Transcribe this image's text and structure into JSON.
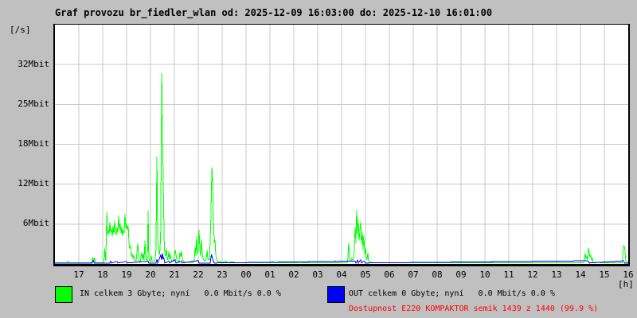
{
  "title": "Graf provozu br_fiedler_wlan od: 2025-12-09 16:03:00 do: 2025-12-10 16:01:00",
  "colors": {
    "background": "#c0c0c0",
    "plot_background": "#ffffff",
    "grid": "#c9c9c9",
    "border": "#000000",
    "in": "#00ff00",
    "out": "#0000ff",
    "availability_text": "#ff0000"
  },
  "legend": {
    "in": {
      "label": "IN celkem 3 Gbyte; nyní   0.0 Mbit/s 0.0 %",
      "color": "#00ff00"
    },
    "out": {
      "label": "OUT celkem 0 Gbyte; nyní   0.0 Mbit/s 0.0 %",
      "color": "#0000ff"
    },
    "availability": {
      "label": "Dostupnost E220 KOMPAKTOR semik 1439 z 1440 (99.9 %)",
      "color": "#ff0000"
    }
  },
  "chart_data": {
    "type": "line",
    "title": "Graf provozu br_fiedler_wlan od: 2025-12-09 16:03:00 do: 2025-12-10 16:01:00",
    "y_unit_label": "[/s]",
    "x_unit_label": "[h]",
    "y_tick_labels": [
      "32Mbit",
      "25Mbit",
      "18Mbit",
      "12Mbit",
      "6Mbit"
    ],
    "x_tick_labels": [
      "17",
      "18",
      "19",
      "20",
      "21",
      "22",
      "23",
      "00",
      "01",
      "02",
      "03",
      "04",
      "05",
      "06",
      "07",
      "08",
      "09",
      "10",
      "11",
      "12",
      "13",
      "14",
      "15",
      "16"
    ],
    "x_range_hours": [
      16.05,
      40.0
    ],
    "y_scale_mbit_per_gridline": 6,
    "grid": true,
    "legend_position": "bottom",
    "series": [
      {
        "name": "IN",
        "unit": "Mbit/s",
        "color_key": "in",
        "points": [
          [
            16.0,
            0.05
          ],
          [
            16.5,
            0.05
          ],
          [
            16.55,
            0.3
          ],
          [
            16.6,
            0.05
          ],
          [
            17.55,
            0.05
          ],
          [
            17.58,
            0.9
          ],
          [
            17.62,
            0.3
          ],
          [
            17.65,
            0.8
          ],
          [
            17.7,
            0.1
          ],
          [
            17.9,
            0.05
          ],
          [
            18.05,
            0.1
          ],
          [
            18.08,
            2.2
          ],
          [
            18.12,
            0.5
          ],
          [
            18.13,
            0.4
          ],
          [
            18.17,
            7.7
          ],
          [
            18.2,
            4.2
          ],
          [
            18.23,
            5.0
          ],
          [
            18.27,
            4.4
          ],
          [
            18.3,
            6.2
          ],
          [
            18.33,
            4.6
          ],
          [
            18.37,
            5.2
          ],
          [
            18.4,
            4.0
          ],
          [
            18.43,
            5.6
          ],
          [
            18.47,
            4.3
          ],
          [
            18.5,
            6.4
          ],
          [
            18.53,
            4.8
          ],
          [
            18.57,
            4.2
          ],
          [
            18.6,
            5.4
          ],
          [
            18.63,
            4.6
          ],
          [
            18.67,
            7.1
          ],
          [
            18.7,
            5.0
          ],
          [
            18.73,
            6.0
          ],
          [
            18.77,
            4.4
          ],
          [
            18.8,
            5.5
          ],
          [
            18.83,
            4.1
          ],
          [
            18.87,
            5.0
          ],
          [
            18.9,
            4.5
          ],
          [
            18.93,
            7.4
          ],
          [
            18.97,
            5.2
          ],
          [
            19.0,
            6.0
          ],
          [
            19.03,
            5.0
          ],
          [
            19.07,
            5.6
          ],
          [
            19.1,
            3.0
          ],
          [
            19.13,
            2.2
          ],
          [
            19.17,
            2.6
          ],
          [
            19.2,
            1.0
          ],
          [
            19.23,
            1.5
          ],
          [
            19.27,
            0.7
          ],
          [
            19.3,
            1.2
          ],
          [
            19.33,
            0.4
          ],
          [
            19.4,
            0.3
          ],
          [
            19.47,
            3.0
          ],
          [
            19.5,
            0.4
          ],
          [
            19.57,
            0.2
          ],
          [
            19.63,
            1.6
          ],
          [
            19.67,
            0.5
          ],
          [
            19.7,
            1.5
          ],
          [
            19.73,
            0.4
          ],
          [
            19.77,
            3.4
          ],
          [
            19.8,
            0.6
          ],
          [
            19.87,
            0.4
          ],
          [
            19.9,
            7.9
          ],
          [
            19.93,
            0.6
          ],
          [
            20.0,
            0.2
          ],
          [
            20.03,
            1.1
          ],
          [
            20.07,
            0.3
          ],
          [
            20.17,
            0.3
          ],
          [
            20.2,
            0.6
          ],
          [
            20.23,
            2.2
          ],
          [
            20.27,
            16.0
          ],
          [
            20.3,
            4.2
          ],
          [
            20.33,
            2.4
          ],
          [
            20.37,
            1.2
          ],
          [
            20.4,
            2.0
          ],
          [
            20.43,
            5.2
          ],
          [
            20.47,
            28.6
          ],
          [
            20.5,
            20.0
          ],
          [
            20.53,
            13.5
          ],
          [
            20.55,
            8.3
          ],
          [
            20.58,
            2.4
          ],
          [
            20.6,
            1.6
          ],
          [
            20.63,
            1.0
          ],
          [
            20.67,
            2.2
          ],
          [
            20.7,
            0.6
          ],
          [
            20.73,
            0.5
          ],
          [
            20.77,
            1.8
          ],
          [
            20.8,
            0.6
          ],
          [
            20.83,
            1.3
          ],
          [
            20.87,
            0.3
          ],
          [
            20.97,
            0.6
          ],
          [
            21.0,
            0.9
          ],
          [
            21.03,
            2.0
          ],
          [
            21.07,
            1.3
          ],
          [
            21.1,
            0.5
          ],
          [
            21.17,
            0.2
          ],
          [
            21.2,
            0.4
          ],
          [
            21.23,
            1.6
          ],
          [
            21.27,
            1.0
          ],
          [
            21.3,
            1.8
          ],
          [
            21.33,
            0.8
          ],
          [
            21.37,
            0.3
          ],
          [
            21.5,
            0.1
          ],
          [
            21.8,
            0.1
          ],
          [
            21.83,
            0.4
          ],
          [
            21.87,
            2.5
          ],
          [
            21.9,
            1.1
          ],
          [
            21.93,
            4.0
          ],
          [
            21.97,
            1.4
          ],
          [
            22.0,
            2.0
          ],
          [
            22.03,
            5.0
          ],
          [
            22.07,
            2.0
          ],
          [
            22.1,
            1.0
          ],
          [
            22.13,
            3.6
          ],
          [
            22.17,
            1.3
          ],
          [
            22.2,
            0.7
          ],
          [
            22.27,
            0.3
          ],
          [
            22.33,
            0.5
          ],
          [
            22.37,
            2.0
          ],
          [
            22.4,
            0.6
          ],
          [
            22.47,
            0.5
          ],
          [
            22.5,
            3.5
          ],
          [
            22.53,
            7.0
          ],
          [
            22.57,
            14.4
          ],
          [
            22.6,
            12.3
          ],
          [
            22.63,
            7.0
          ],
          [
            22.67,
            3.0
          ],
          [
            22.7,
            3.5
          ],
          [
            22.73,
            1.4
          ],
          [
            22.77,
            0.5
          ],
          [
            22.83,
            0.2
          ],
          [
            22.9,
            0.3
          ],
          [
            23.0,
            0.1
          ],
          [
            23.17,
            0.3
          ],
          [
            23.2,
            0.1
          ],
          [
            23.5,
            0.2
          ],
          [
            23.53,
            0.05
          ],
          [
            24.1,
            0.05
          ],
          [
            24.13,
            0.2
          ],
          [
            24.17,
            0.05
          ],
          [
            25.05,
            0.05
          ],
          [
            25.1,
            0.3
          ],
          [
            25.13,
            0.05
          ],
          [
            26.25,
            0.05
          ],
          [
            26.3,
            0.2
          ],
          [
            26.33,
            0.05
          ],
          [
            27.15,
            0.05
          ],
          [
            27.2,
            0.25
          ],
          [
            27.23,
            0.05
          ],
          [
            27.7,
            0.05
          ],
          [
            27.73,
            0.35
          ],
          [
            27.77,
            0.05
          ],
          [
            28.25,
            0.1
          ],
          [
            28.3,
            3.1
          ],
          [
            28.33,
            0.4
          ],
          [
            28.4,
            0.3
          ],
          [
            28.43,
            0.7
          ],
          [
            28.47,
            0.4
          ],
          [
            28.5,
            0.6
          ],
          [
            28.53,
            2.0
          ],
          [
            28.57,
            5.5
          ],
          [
            28.6,
            3.0
          ],
          [
            28.63,
            8.0
          ],
          [
            28.67,
            4.5
          ],
          [
            28.7,
            6.5
          ],
          [
            28.73,
            3.4
          ],
          [
            28.77,
            5.0
          ],
          [
            28.8,
            6.2
          ],
          [
            28.83,
            3.0
          ],
          [
            28.87,
            4.6
          ],
          [
            28.9,
            2.0
          ],
          [
            28.93,
            4.2
          ],
          [
            28.97,
            1.4
          ],
          [
            29.0,
            2.4
          ],
          [
            29.03,
            0.9
          ],
          [
            29.07,
            0.5
          ],
          [
            29.1,
            1.6
          ],
          [
            29.13,
            0.3
          ],
          [
            29.2,
            0.1
          ],
          [
            30.0,
            0.05
          ],
          [
            32.0,
            0.05
          ],
          [
            34.0,
            0.05
          ],
          [
            36.0,
            0.05
          ],
          [
            38.1,
            0.05
          ],
          [
            38.15,
            0.2
          ],
          [
            38.2,
            1.5
          ],
          [
            38.23,
            0.6
          ],
          [
            38.27,
            1.0
          ],
          [
            38.3,
            0.5
          ],
          [
            38.33,
            2.3
          ],
          [
            38.37,
            1.6
          ],
          [
            38.4,
            0.9
          ],
          [
            38.43,
            1.2
          ],
          [
            38.47,
            0.4
          ],
          [
            38.5,
            0.8
          ],
          [
            38.53,
            0.15
          ],
          [
            39.0,
            0.05
          ],
          [
            39.03,
            0.2
          ],
          [
            39.07,
            0.05
          ],
          [
            39.75,
            0.05
          ],
          [
            39.8,
            2.6
          ],
          [
            39.85,
            2.4
          ],
          [
            39.9,
            0.3
          ],
          [
            39.95,
            0.1
          ],
          [
            40.0,
            0.1
          ]
        ]
      },
      {
        "name": "OUT",
        "unit": "Mbit/s",
        "color_key": "out",
        "points": [
          [
            16.0,
            0.02
          ],
          [
            17.55,
            0.02
          ],
          [
            17.6,
            0.4
          ],
          [
            17.65,
            0.02
          ],
          [
            18.3,
            0.02
          ],
          [
            18.33,
            0.3
          ],
          [
            18.37,
            0.02
          ],
          [
            18.6,
            0.25
          ],
          [
            18.63,
            0.02
          ],
          [
            19.0,
            0.25
          ],
          [
            19.03,
            0.02
          ],
          [
            19.9,
            0.3
          ],
          [
            19.93,
            0.02
          ],
          [
            20.23,
            0.02
          ],
          [
            20.27,
            0.6
          ],
          [
            20.3,
            0.02
          ],
          [
            20.43,
            1.2
          ],
          [
            20.47,
            0.5
          ],
          [
            20.5,
            1.5
          ],
          [
            20.53,
            0.6
          ],
          [
            20.55,
            0.9
          ],
          [
            20.6,
            0.02
          ],
          [
            20.77,
            0.3
          ],
          [
            20.8,
            0.02
          ],
          [
            21.03,
            0.5
          ],
          [
            21.07,
            0.02
          ],
          [
            21.3,
            0.3
          ],
          [
            21.33,
            0.02
          ],
          [
            22.0,
            0.4
          ],
          [
            22.03,
            0.02
          ],
          [
            22.5,
            0.02
          ],
          [
            22.55,
            1.3
          ],
          [
            22.6,
            0.7
          ],
          [
            22.63,
            0.3
          ],
          [
            22.67,
            0.02
          ],
          [
            28.57,
            0.3
          ],
          [
            28.6,
            0.02
          ],
          [
            28.67,
            0.45
          ],
          [
            28.7,
            0.02
          ],
          [
            28.8,
            0.5
          ],
          [
            28.83,
            0.02
          ],
          [
            28.93,
            0.3
          ],
          [
            29.0,
            0.02
          ],
          [
            38.3,
            0.35
          ],
          [
            38.37,
            0.02
          ],
          [
            39.8,
            0.35
          ],
          [
            39.85,
            0.02
          ],
          [
            40.0,
            0.02
          ]
        ]
      }
    ]
  }
}
